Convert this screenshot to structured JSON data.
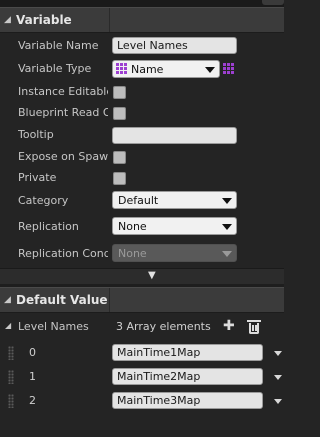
{
  "variable_section": {
    "title": "Variable",
    "rows": {
      "variable_name": {
        "label": "Variable Name",
        "value": "Level Names"
      },
      "variable_type": {
        "label": "Variable Type",
        "value": "Name"
      },
      "instance_editable": {
        "label": "Instance Editable"
      },
      "blueprint_read_only": {
        "label": "Blueprint Read Or"
      },
      "tooltip": {
        "label": "Tooltip",
        "value": ""
      },
      "expose_on_spawn": {
        "label": "Expose on Spawn"
      },
      "private": {
        "label": "Private"
      },
      "category": {
        "label": "Category",
        "value": "Default"
      },
      "replication": {
        "label": "Replication",
        "value": "None"
      },
      "replication_condition": {
        "label": "Replication Condi",
        "value": "None"
      }
    }
  },
  "default_value_section": {
    "title": "Default Value",
    "array": {
      "label": "Level Names",
      "summary": "3 Array elements",
      "elements": [
        {
          "index": "0",
          "value": "MainTime1Map"
        },
        {
          "index": "1",
          "value": "MainTime2Map"
        },
        {
          "index": "2",
          "value": "MainTime3Map"
        }
      ]
    }
  },
  "icons": {
    "type_pin": "grid-icon",
    "container_type": "grid-icon",
    "add": "plus-icon",
    "delete": "trash-icon",
    "expand": "chevron-down-icon"
  },
  "colors": {
    "type_pin_color": "#9d3fd1",
    "panel_bg": "#242424",
    "header_bg": "#3b3b3b"
  }
}
